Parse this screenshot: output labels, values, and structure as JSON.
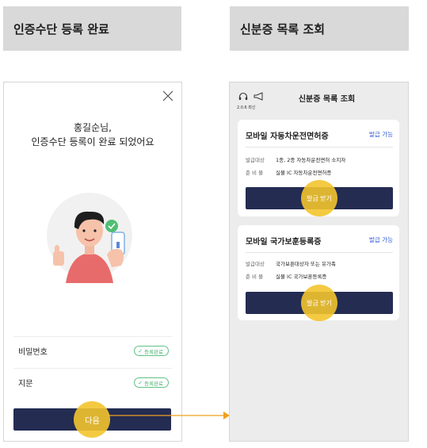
{
  "left_panel": {
    "header": "인증수단 등록 완료",
    "message_line1": "홍길순님,",
    "message_line2": "인증수단 등록이 완료 되었어요",
    "rows": [
      {
        "label": "비밀번호",
        "badge": "등록완료"
      },
      {
        "label": "지문",
        "badge": "등록완료"
      }
    ],
    "next_button": "다음"
  },
  "right_panel": {
    "header": "신분증 목록 조회",
    "screen_title": "신분증 목록 조회",
    "version": "2.0.6 최신",
    "cards": [
      {
        "title": "모바일 자동차운전면허증",
        "status": "발급 가능",
        "rows": [
          {
            "key": "발급대상",
            "value": "1종, 2종 자동차운전면허 소지자"
          },
          {
            "key": "준 비 물",
            "value": "실물 IC 자동차운전면허증"
          }
        ],
        "button": "발급 받기"
      },
      {
        "title": "모바일 국가보훈등록증",
        "status": "발급 가능",
        "rows": [
          {
            "key": "발급대상",
            "value": "국가보훈대상자 또는 유가족"
          },
          {
            "key": "준 비 물",
            "value": "실물 IC 국가보훈등록증"
          }
        ],
        "button": "발급 받기"
      }
    ]
  },
  "colors": {
    "primary_button": "#242c52",
    "highlight": "#f3c42e",
    "success": "#4ab46f",
    "status_link": "#2f5bd3",
    "arrow": "#f0a020"
  },
  "icons": [
    "close-icon",
    "check-icon",
    "headset-icon",
    "megaphone-icon",
    "arrow-right-icon"
  ]
}
